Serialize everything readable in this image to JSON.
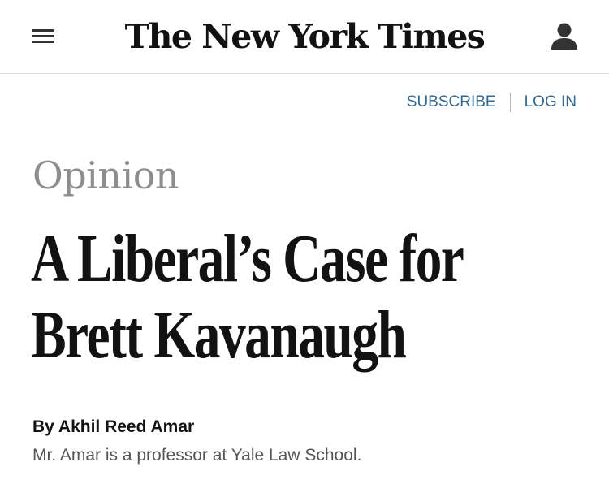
{
  "header": {
    "logo_text": "The New York Times",
    "menu_icon": "hamburger-menu-icon",
    "account_icon": "user-account-icon"
  },
  "auth": {
    "subscribe_label": "SUBSCRIBE",
    "login_label": "LOG IN",
    "link_color": "#326891"
  },
  "article": {
    "section": "Opinion",
    "headline_lines": [
      "A Liberal’s Case for",
      "Brett Kavanaugh"
    ],
    "byline": "By Akhil Reed Amar",
    "author_bio": "Mr. Amar is a professor at Yale Law School."
  }
}
